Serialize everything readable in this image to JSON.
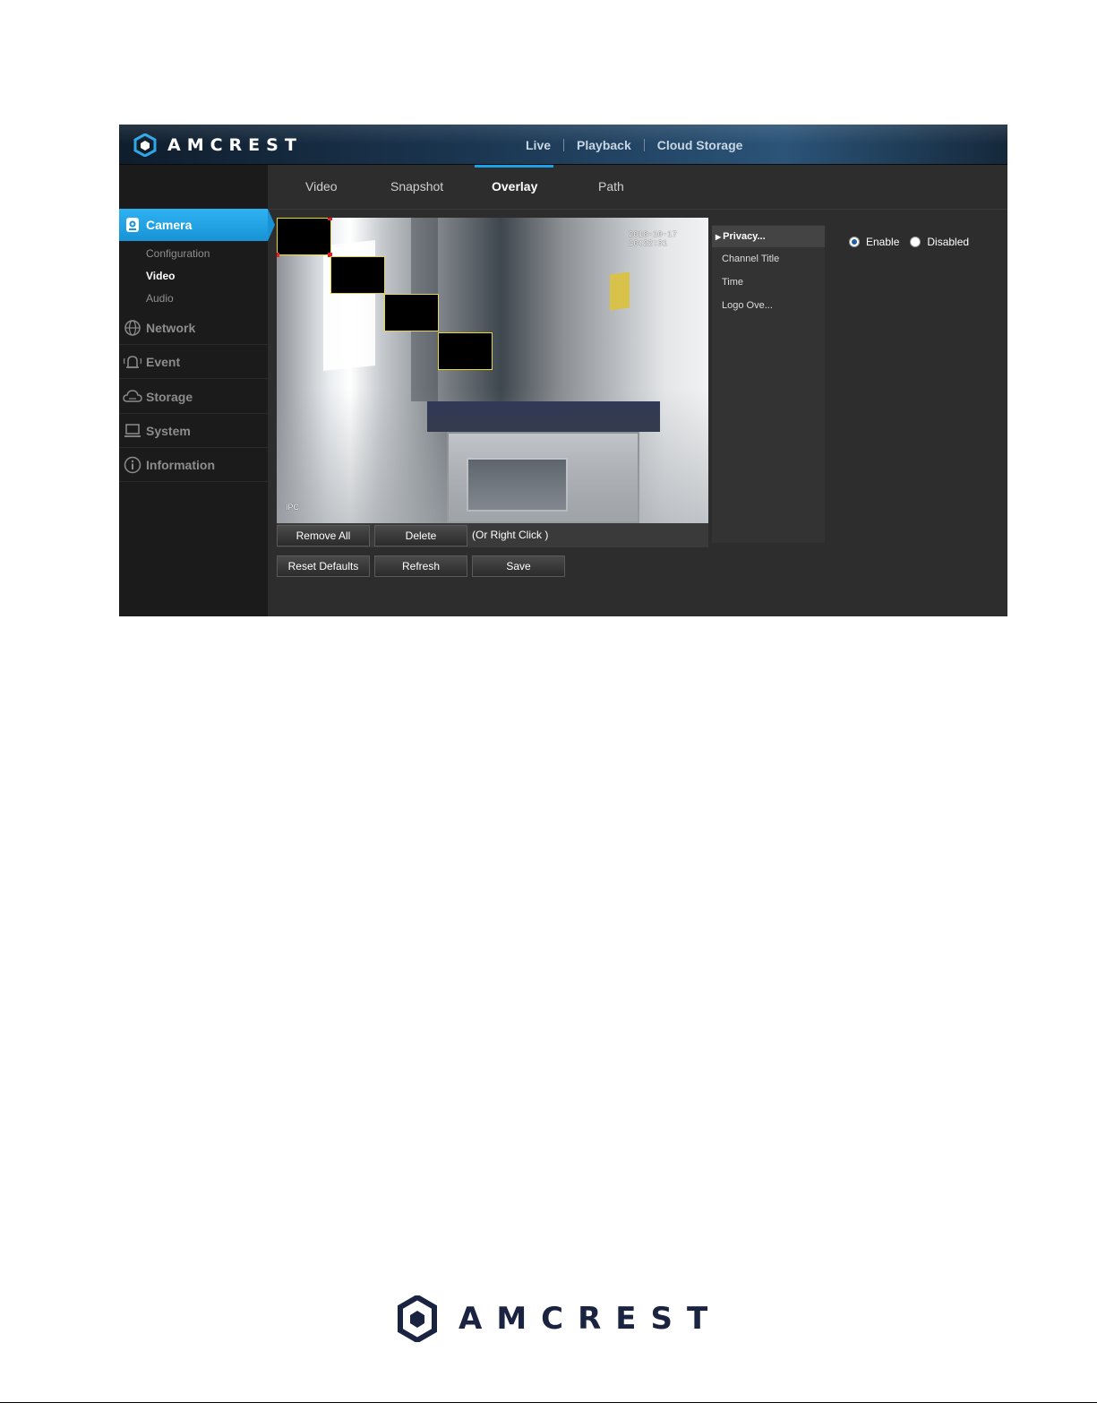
{
  "brand": {
    "name": "AMCREST"
  },
  "topnav": {
    "live": "Live",
    "playback": "Playback",
    "cloud_storage": "Cloud Storage"
  },
  "sidebar": {
    "camera": "Camera",
    "camera_sub": [
      "Configuration",
      "Video",
      "Audio"
    ],
    "network": "Network",
    "event": "Event",
    "storage": "Storage",
    "system": "System",
    "information": "Information"
  },
  "tabs": [
    "Video",
    "Snapshot",
    "Overlay",
    "Path"
  ],
  "video": {
    "osd_time": "2018-10-17 10:22:31",
    "osd_channel": "IPC",
    "privacy_mask_count": 4
  },
  "toolbar": {
    "remove_all": "Remove All",
    "delete": "Delete",
    "hint": "(Or Right Click )",
    "reset_defaults": "Reset Defaults",
    "refresh": "Refresh",
    "save": "Save"
  },
  "overlay_menu": {
    "active_marker": "▶",
    "items": [
      "Privacy...",
      "Channel Title",
      "Time",
      "Logo Ove..."
    ]
  },
  "privacy": {
    "enable_label": "Enable",
    "disabled_label": "Disabled",
    "selected": "Enable"
  },
  "colors": {
    "accent": "#1ea0e6",
    "mask_border": "#e8d44a",
    "brand_navy": "#1a2340"
  },
  "icons": {
    "camera": "camera-icon",
    "network": "globe-icon",
    "event": "alarm-bell-icon",
    "storage": "cloud-icon",
    "system": "monitor-icon",
    "information": "info-icon"
  }
}
